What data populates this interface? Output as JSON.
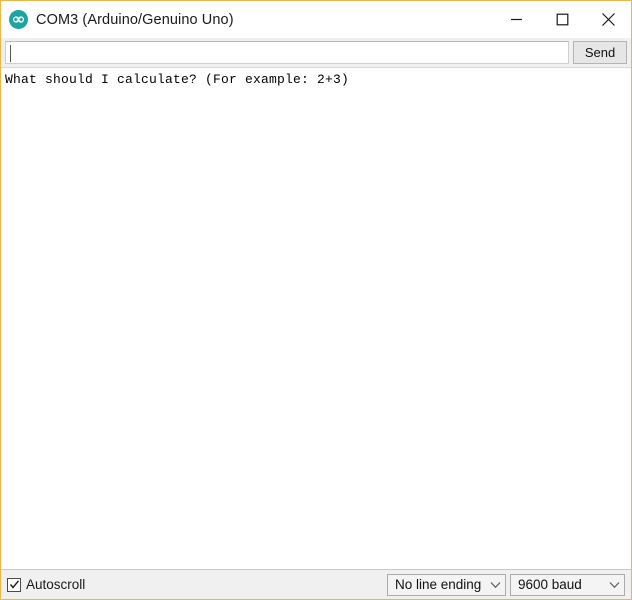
{
  "window": {
    "title": "COM3 (Arduino/Genuino Uno)",
    "icon": "arduino-infinity-icon",
    "border_color": "#e8b84b",
    "controls": {
      "minimize": "minimize-icon",
      "maximize": "maximize-icon",
      "close": "close-icon"
    }
  },
  "toolbar": {
    "input_value": "",
    "input_placeholder": "",
    "send_label": "Send"
  },
  "console": {
    "lines": [
      "What should I calculate? (For example: 2+3)"
    ]
  },
  "statusbar": {
    "autoscroll_label": "Autoscroll",
    "autoscroll_checked": true,
    "checkmark_icon": "check-icon",
    "line_ending": {
      "selected": "No line ending",
      "arrow_icon": "chevron-down-icon"
    },
    "baud_rate": {
      "selected": "9600 baud",
      "arrow_icon": "chevron-down-icon"
    }
  }
}
